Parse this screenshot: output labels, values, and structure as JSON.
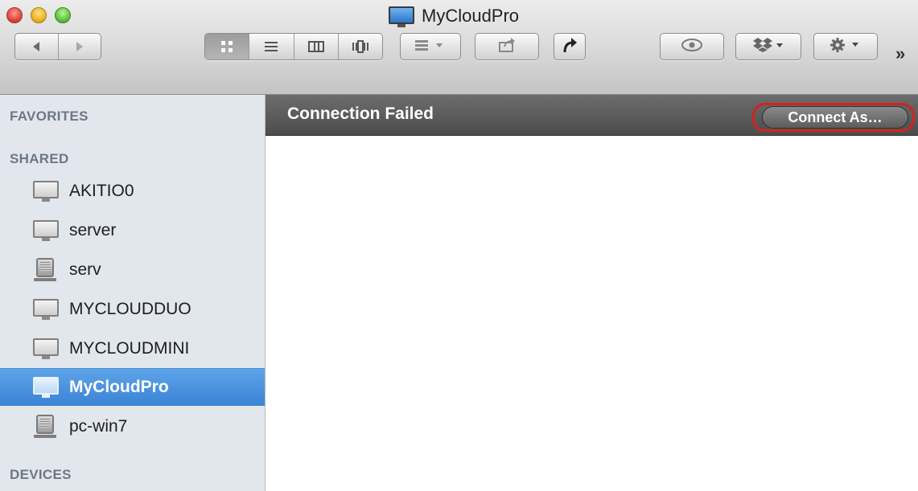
{
  "window": {
    "title": "MyCloudPro",
    "icon": "monitor-icon"
  },
  "toolbar": {
    "back_icon": "back-arrow-icon",
    "forward_icon": "forward-arrow-icon",
    "view_modes": [
      "icon-view-icon",
      "list-view-icon",
      "column-view-icon",
      "coverflow-view-icon"
    ],
    "arrange_icon": "arrange-icon",
    "share_icon": "share-icon",
    "action_icon": "reply-arrow-icon",
    "quicklook_icon": "eye-icon",
    "dropbox_icon": "dropbox-icon",
    "gear_icon": "gear-icon",
    "overflow_label": "»"
  },
  "sidebar": {
    "sections": {
      "favorites": "FAVORITES",
      "shared": "SHARED",
      "devices": "DEVICES"
    },
    "items": [
      {
        "label": "AKITIO0",
        "icon": "monitor-icon"
      },
      {
        "label": "server",
        "icon": "monitor-icon"
      },
      {
        "label": "serv",
        "icon": "pc-icon"
      },
      {
        "label": "MYCLOUDDUO",
        "icon": "monitor-icon"
      },
      {
        "label": "MYCLOUDMINI",
        "icon": "monitor-icon"
      },
      {
        "label": "MyCloudPro",
        "icon": "monitor-icon",
        "selected": true
      },
      {
        "label": "pc-win7",
        "icon": "pc-icon"
      }
    ]
  },
  "main": {
    "status": "Connection Failed",
    "connect_button": "Connect As…"
  },
  "colors": {
    "selection": "#3a83d6",
    "sidebar_bg": "#e2e7ed",
    "status_bar": "#4c4c4c",
    "highlight_outline": "#d3231d"
  }
}
